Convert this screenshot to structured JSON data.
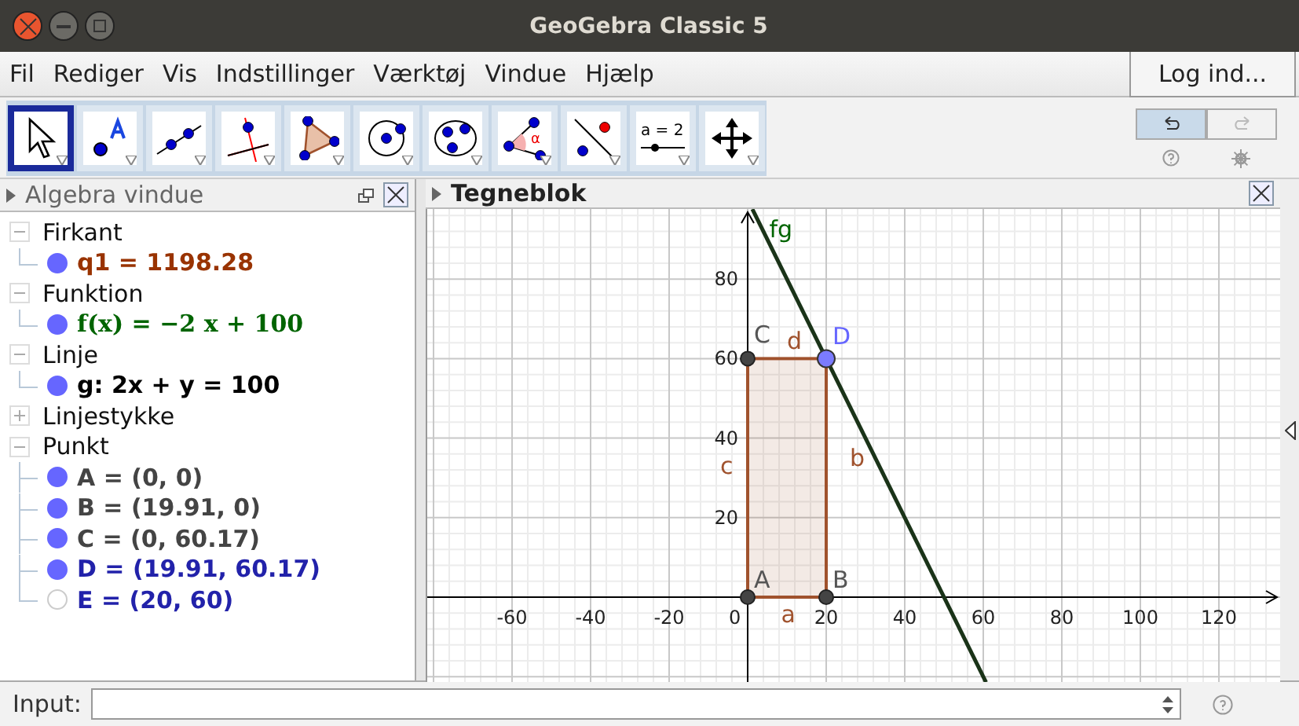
{
  "window": {
    "title": "GeoGebra Classic 5"
  },
  "menu": [
    "Fil",
    "Rediger",
    "Vis",
    "Indstillinger",
    "Værktøj",
    "Vindue",
    "Hjælp"
  ],
  "login_button": "Log ind...",
  "tools": [
    {
      "kind": "pointer",
      "selected": true
    },
    {
      "kind": "point",
      "selected": false
    },
    {
      "kind": "line",
      "selected": false
    },
    {
      "kind": "perpendicular",
      "selected": false
    },
    {
      "kind": "polygon",
      "selected": false
    },
    {
      "kind": "circle",
      "selected": false
    },
    {
      "kind": "conic",
      "selected": false
    },
    {
      "kind": "angle",
      "symbol": "α",
      "selected": false
    },
    {
      "kind": "reflect",
      "selected": false
    },
    {
      "kind": "slider",
      "label": "a = 2",
      "selected": false
    },
    {
      "kind": "move",
      "selected": false
    }
  ],
  "undo": {
    "disabled": false
  },
  "redo": {
    "disabled": true
  },
  "algebra": {
    "title": "Algebra vindue",
    "groups": [
      {
        "label": "Firkant",
        "expanded": true,
        "children": [
          {
            "text": "q1 = 1198.28",
            "kind": "text",
            "visible": true,
            "color": "#993300"
          }
        ]
      },
      {
        "label": "Funktion",
        "expanded": true,
        "children": [
          {
            "text": "f(x) = −2 x + 100",
            "kind": "formula",
            "visible": true,
            "color": "#006400"
          }
        ]
      },
      {
        "label": "Linje",
        "expanded": true,
        "children": [
          {
            "text": "g: 2x + y = 100",
            "kind": "text",
            "visible": true,
            "color": "#000000"
          }
        ]
      },
      {
        "label": "Linjestykke",
        "expanded": false
      },
      {
        "label": "Punkt",
        "expanded": true,
        "children": [
          {
            "text": "A = (0, 0)",
            "kind": "text",
            "visible": true,
            "color": "#444444"
          },
          {
            "text": "B = (19.91, 0)",
            "kind": "text",
            "visible": true,
            "color": "#444444"
          },
          {
            "text": "C = (0, 60.17)",
            "kind": "text",
            "visible": true,
            "color": "#444444"
          },
          {
            "text": "D = (19.91, 60.17)",
            "kind": "text",
            "visible": true,
            "color": "#2222aa"
          },
          {
            "text": "E = (20, 60)",
            "kind": "text",
            "visible": false,
            "color": "#2222aa"
          }
        ]
      }
    ]
  },
  "graphics": {
    "title": "Tegneblok",
    "x_ticks": [
      "-60",
      "-40",
      "-20",
      "0",
      "20",
      "40",
      "60",
      "80",
      "100",
      "120"
    ],
    "y_ticks": [
      "80",
      "60",
      "40",
      "20"
    ],
    "labels": [
      "A",
      "B",
      "C",
      "D",
      "a",
      "b",
      "c",
      "d",
      "fg"
    ]
  },
  "input": {
    "label": "Input:"
  }
}
